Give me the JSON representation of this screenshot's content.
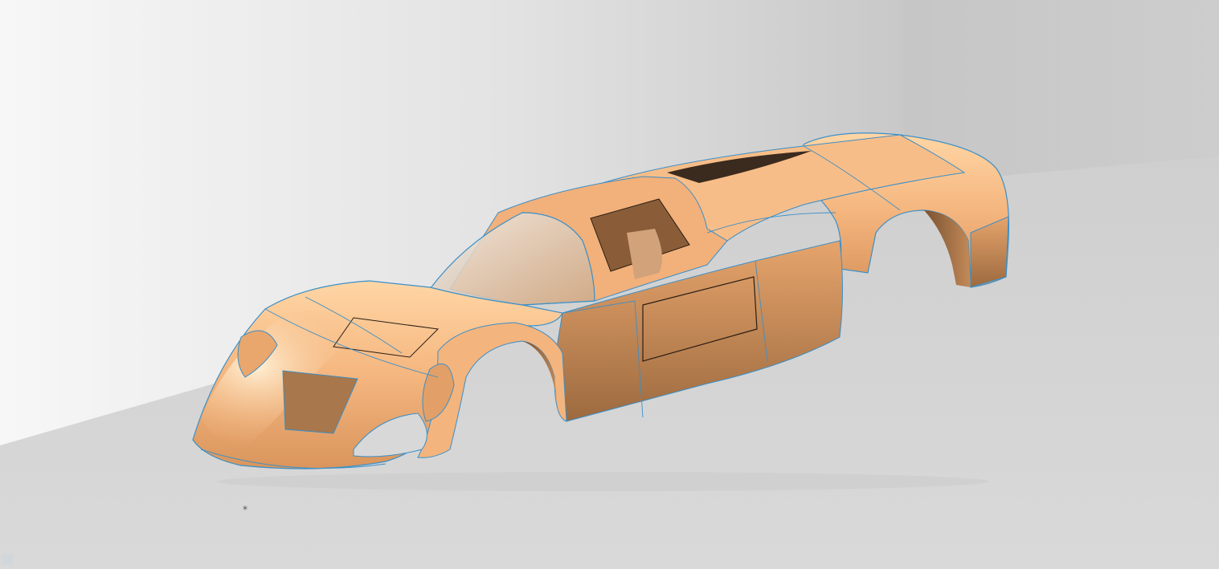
{
  "viewport": {
    "kind": "3d-cad-viewport",
    "render_mode": "shaded-with-edges",
    "background_colors": {
      "wall_left": "#f6f6f6",
      "wall_right": "#c9c9c9",
      "floor": "#d4d4d4"
    }
  },
  "model": {
    "subject": "race-car-body-shell",
    "surface_color": "#f2b07a",
    "surface_shadow_color": "#a87447",
    "surface_highlight_color": "#ffe0b4",
    "boundary_edge_color": "#3a8fc8",
    "feature_edge_color": "#2a1d14"
  },
  "markers": {
    "origin_marker_glyph": "*",
    "origin_marker_color": "#555555"
  },
  "icons": {
    "triad": "axis-triad-icon"
  }
}
